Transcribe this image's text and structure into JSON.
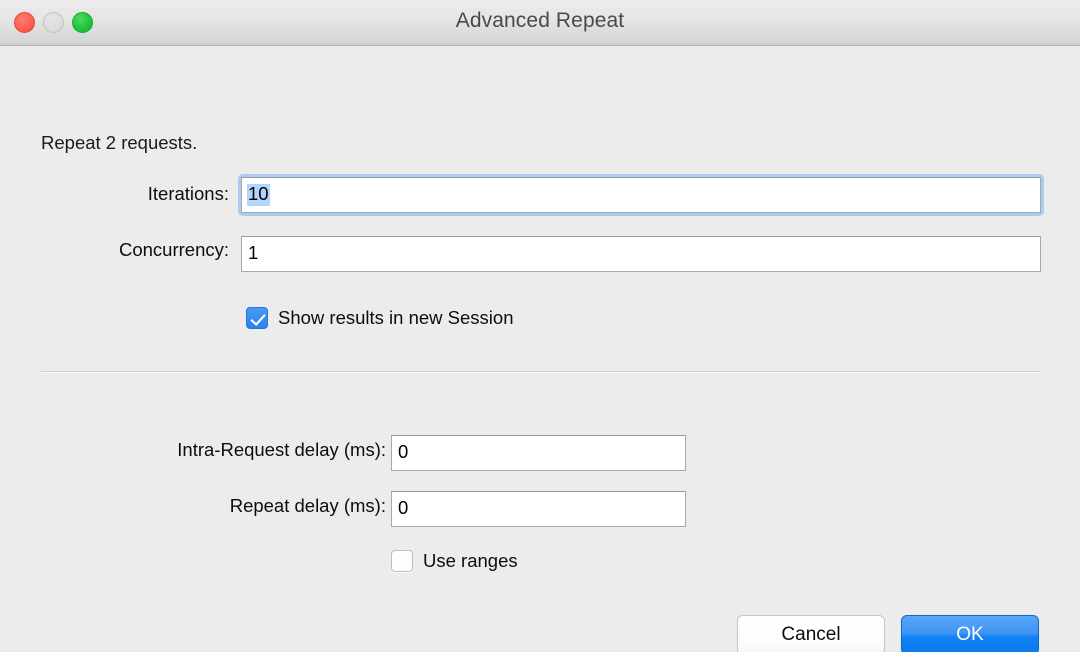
{
  "window": {
    "title": "Advanced Repeat",
    "traffic_lights": {
      "close": "close-button",
      "minimize": "minimize-button",
      "zoom": "zoom-button"
    }
  },
  "main": {
    "intro_text": "Repeat 2 requests.",
    "fields": {
      "iterations": {
        "label": "Iterations:",
        "value": "10",
        "focused": true,
        "text_selected": true
      },
      "concurrency": {
        "label": "Concurrency:",
        "value": "1",
        "focused": false,
        "text_selected": false
      },
      "intra_request_delay": {
        "label": "Intra-Request delay (ms):",
        "value": "0"
      },
      "repeat_delay": {
        "label": "Repeat delay (ms):",
        "value": "0"
      }
    },
    "checkboxes": {
      "show_results": {
        "label": "Show results in new Session",
        "checked": true
      },
      "use_ranges": {
        "label": "Use ranges",
        "checked": false
      }
    }
  },
  "footer": {
    "cancel_label": "Cancel",
    "ok_label": "OK"
  },
  "colors": {
    "accent_blue": "#2a82ec",
    "default_button_blue": "#1182f2",
    "selection_blue": "#b3d4fc",
    "focus_ring_blue": "#a8cdf0",
    "window_background": "#ececec",
    "titlebar_top": "#ececec",
    "titlebar_bottom": "#cfcfcf",
    "close_red": "#ff5f52",
    "minimize_gray": "#dcdcdc",
    "zoom_green": "#22c53c",
    "divider_gray": "#d2d2d2"
  }
}
